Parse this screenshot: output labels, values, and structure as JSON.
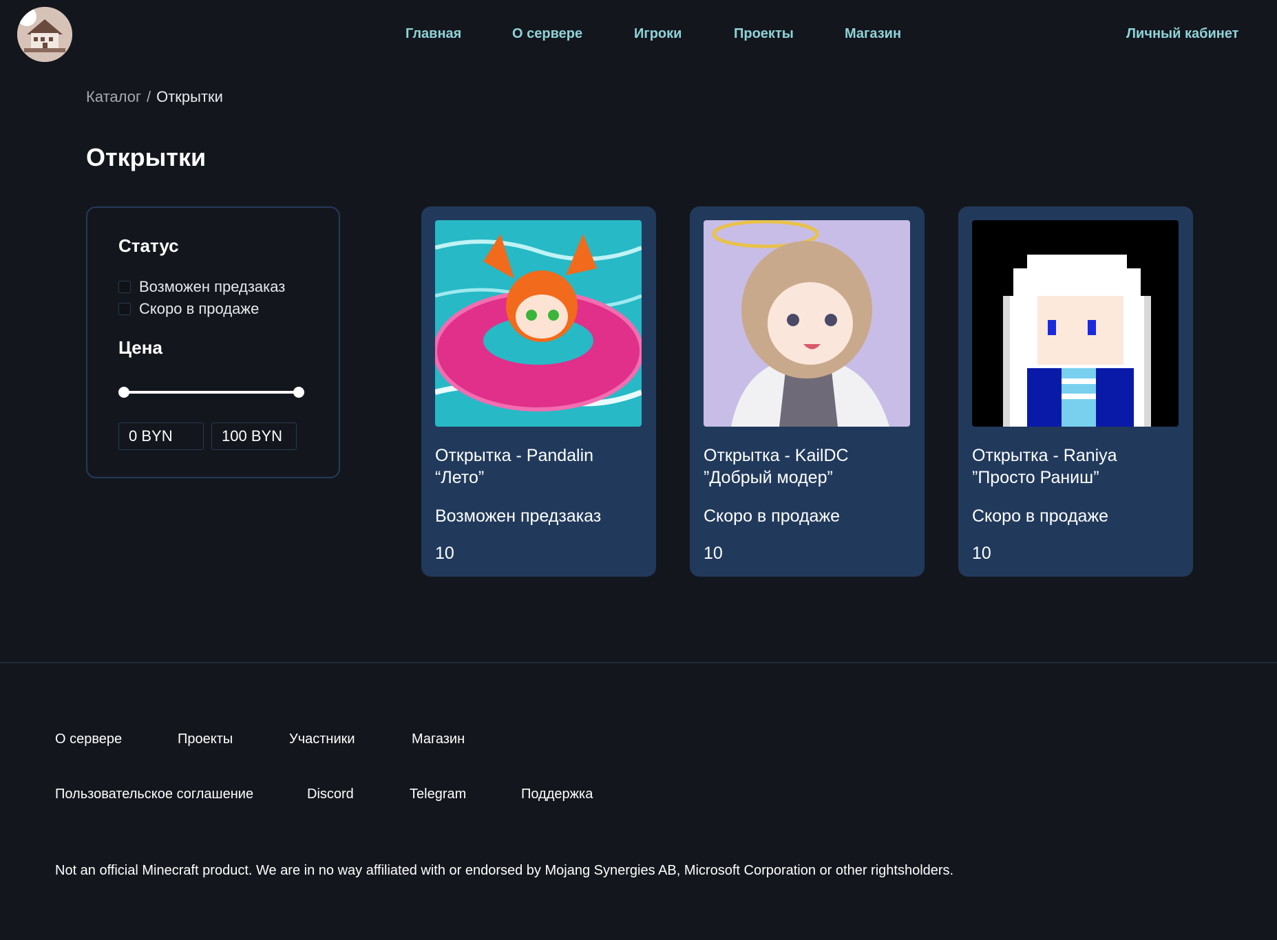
{
  "nav": {
    "items": [
      "Главная",
      "О сервере",
      "Игроки",
      "Проекты",
      "Магазин"
    ],
    "account": "Личный кабинет"
  },
  "breadcrumb": {
    "catalog": "Каталог",
    "separator": "/",
    "current": "Открытки"
  },
  "page_title": "Открытки",
  "filters": {
    "status_heading": "Статус",
    "status_options": [
      "Возможен предзаказ",
      "Скоро в продаже"
    ],
    "price_heading": "Цена",
    "price_min": "0 BYN",
    "price_max": "100 BYN"
  },
  "cards": [
    {
      "title_line1": "Открытка - Pandalin",
      "title_line2": "“Лето”",
      "status": "Возможен предзаказ",
      "price": "10"
    },
    {
      "title_line1": "Открытка - KailDC",
      "title_line2": "”Добрый модер”",
      "status": "Скоро в продаже",
      "price": "10"
    },
    {
      "title_line1": "Открытка - Raniya",
      "title_line2": "”Просто Раниш”",
      "status": "Скоро в продаже",
      "price": "10"
    }
  ],
  "footer": {
    "row1": [
      "О сервере",
      "Проекты",
      "Участники",
      "Магазин"
    ],
    "row2": [
      "Пользовательское соглашение",
      "Discord",
      "Telegram",
      "Поддержка"
    ],
    "disclaimer": "Not an official Minecraft product. We are in no way affiliated with or endorsed by Mojang Synergies AB, Microsoft Corporation or other rightsholders."
  },
  "colors": {
    "background": "#13171d",
    "card": "#213a5c",
    "nav_accent": "#8fd3d8",
    "panel_border": "#243a5c"
  }
}
